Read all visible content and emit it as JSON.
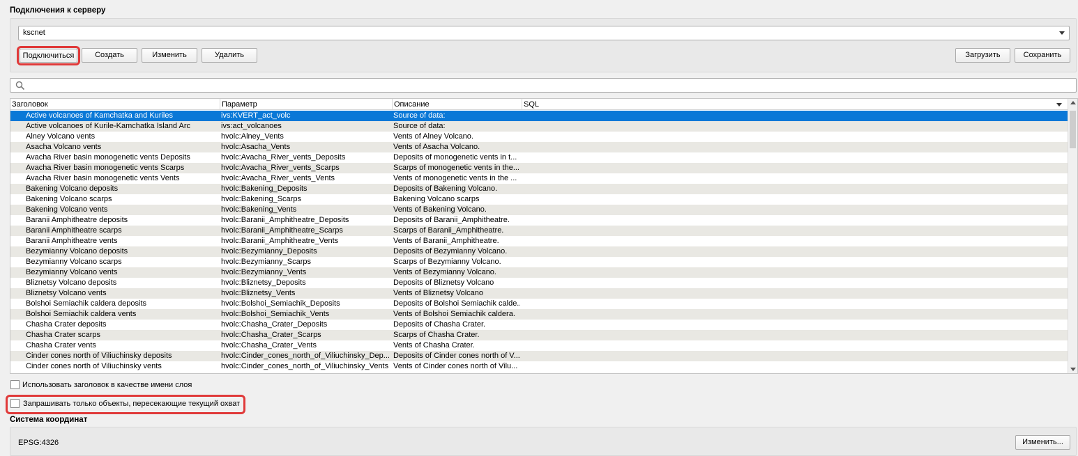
{
  "server": {
    "title": "Подключения к серверу",
    "connection": "kscnet",
    "buttons": {
      "connect": "Подключиться",
      "create": "Создать",
      "edit": "Изменить",
      "delete": "Удалить",
      "load": "Загрузить",
      "save": "Сохранить"
    }
  },
  "search": {
    "placeholder": ""
  },
  "table": {
    "columns": [
      "Заголовок",
      "Параметр",
      "Описание",
      "SQL"
    ],
    "rows": [
      [
        "Active volcanoes of Kamchatka and Kuriles",
        "ivs:KVERT_act_volc",
        "Source of data:"
      ],
      [
        "Active volcanoes of Kurile-Kamchatka Island Arc",
        "ivs:act_volcanoes",
        "Source of data:"
      ],
      [
        "Alney Volcano vents",
        "hvolc:Alney_Vents",
        "Vents of Alney Volcano."
      ],
      [
        "Asacha Volcano vents",
        "hvolc:Asacha_Vents",
        "Vents of Asacha Volcano."
      ],
      [
        "Avacha River basin monogenetic vents Deposits",
        "hvolc:Avacha_River_vents_Deposits",
        "Deposits of monogenetic vents in t..."
      ],
      [
        "Avacha River basin monogenetic vents Scarps",
        "hvolc:Avacha_River_vents_Scarps",
        "Scarps of monogenetic vents in the..."
      ],
      [
        "Avacha River basin monogenetic vents Vents",
        "hvolc:Avacha_River_vents_Vents",
        "Vents of monogenetic vents in the ..."
      ],
      [
        "Bakening Volcano deposits",
        "hvolc:Bakening_Deposits",
        "Deposits of Bakening Volcano."
      ],
      [
        "Bakening Volcano scarps",
        "hvolc:Bakening_Scarps",
        "Bakening Volcano scarps"
      ],
      [
        "Bakening Volcano vents",
        "hvolc:Bakening_Vents",
        "Vents of Bakening Volcano."
      ],
      [
        "Baranii Amphitheatre deposits",
        "hvolc:Baranii_Amphitheatre_Deposits",
        "Deposits of Baranii_Amphitheatre."
      ],
      [
        "Baranii Amphitheatre scarps",
        "hvolc:Baranii_Amphitheatre_Scarps",
        "Scarps of Baranii_Amphitheatre."
      ],
      [
        "Baranii Amphitheatre vents",
        "hvolc:Baranii_Amphitheatre_Vents",
        "Vents of Baranii_Amphitheatre."
      ],
      [
        "Bezymianny Volcano deposits",
        "hvolc:Bezymianny_Deposits",
        "Deposits of Bezymianny Volcano."
      ],
      [
        "Bezymianny Volcano scarps",
        "hvolc:Bezymianny_Scarps",
        "Scarps of Bezymianny Volcano."
      ],
      [
        "Bezymianny Volcano vents",
        "hvolc:Bezymianny_Vents",
        "Vents of Bezymianny Volcano."
      ],
      [
        "Bliznetsy Volcano deposits",
        "hvolc:Bliznetsy_Deposits",
        "Deposits of Bliznetsy Volcano"
      ],
      [
        "Bliznetsy Volcano vents",
        "hvolc:Bliznetsy_Vents",
        "Vents of Bliznetsy Volcano"
      ],
      [
        "Bolshoi Semiachik caldera deposits",
        "hvolc:Bolshoi_Semiachik_Deposits",
        "Deposits of Bolshoi Semiachik calde..."
      ],
      [
        "Bolshoi Semiachik caldera vents",
        "hvolc:Bolshoi_Semiachik_Vents",
        "Vents of Bolshoi Semiachik caldera."
      ],
      [
        "Chasha Crater deposits",
        "hvolc:Chasha_Crater_Deposits",
        "Deposits of Chasha Crater."
      ],
      [
        "Chasha Crater scarps",
        "hvolc:Chasha_Crater_Scarps",
        "Scarps of Chasha Crater."
      ],
      [
        "Chasha Crater vents",
        "hvolc:Chasha_Crater_Vents",
        "Vents of Chasha Crater."
      ],
      [
        "Cinder cones north of Viliuchinsky deposits",
        "hvolc:Cinder_cones_north_of_Viliuchinsky_Dep...",
        "Deposits of Cinder cones north of V..."
      ],
      [
        "Cinder cones north of Viliuchinsky vents",
        "hvolc:Cinder_cones_north_of_Viliuchinsky_Vents",
        "Vents of Cinder cones north of Vilu..."
      ]
    ]
  },
  "options": {
    "use_title": "Использовать заголовок в качестве имени слоя",
    "extent_only": "Запрашивать только объекты, пересекающие текущий охват"
  },
  "crs": {
    "title": "Система координат",
    "value": "EPSG:4326",
    "change": "Изменить..."
  },
  "colors": {
    "selection": "#0a78d7",
    "highlight": "#e03a3a"
  }
}
